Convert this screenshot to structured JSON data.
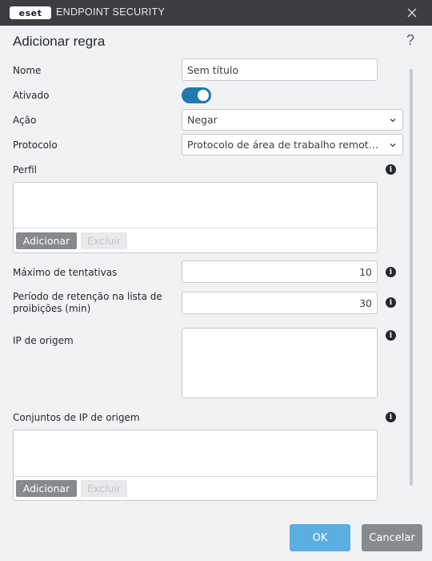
{
  "window": {
    "logo_text": "eset",
    "app_name": "ENDPOINT SECURITY",
    "close_icon": "close-icon"
  },
  "dialog": {
    "title": "Adicionar regra",
    "help_glyph": "?"
  },
  "fields": {
    "name": {
      "label": "Nome",
      "placeholder": "Sem título"
    },
    "enabled": {
      "label": "Ativado",
      "value": true
    },
    "action": {
      "label": "Ação",
      "value": "Negar"
    },
    "protocol": {
      "label": "Protocolo",
      "value": "Protocolo de área de trabalho remota (RDP)"
    },
    "profile": {
      "label": "Perfil"
    },
    "max_attempts": {
      "label": "Máximo de tentativas",
      "value": "10"
    },
    "retention": {
      "label": "Período de retenção na lista de proibições (min)",
      "value": "30"
    },
    "source_ip": {
      "label": "IP de origem",
      "value": ""
    },
    "source_ip_sets": {
      "label": "Conjuntos de IP de origem"
    }
  },
  "list_buttons": {
    "add": "Adicionar",
    "delete": "Excluir"
  },
  "footer": {
    "ok": "OK",
    "cancel": "Cancelar"
  },
  "colors": {
    "titlebar": "#3b3d40",
    "toggle_on": "#2279ac",
    "ok_button": "#5aaee0",
    "cancel_button": "#878b90"
  }
}
